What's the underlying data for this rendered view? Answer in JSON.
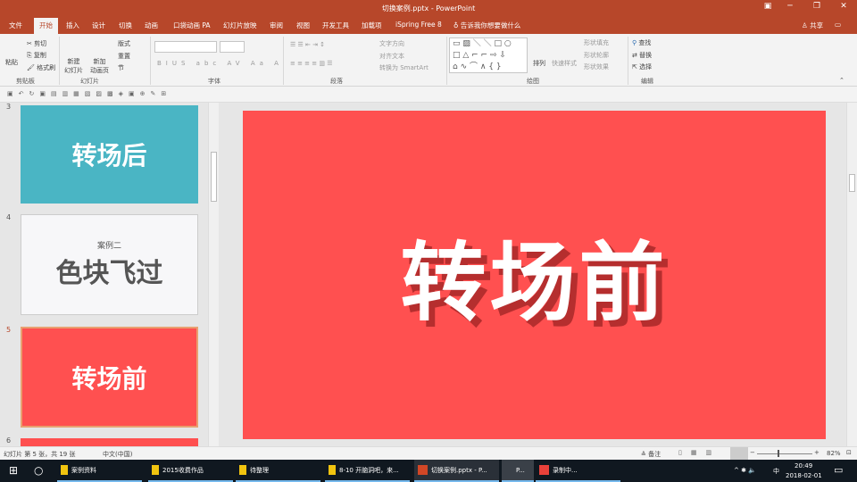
{
  "title": "切换案例.pptx - PowerPoint",
  "tabs": [
    "文件",
    "开始",
    "插入",
    "设计",
    "切换",
    "动画",
    "口袋动画 PA",
    "幻灯片放映",
    "审阅",
    "视图",
    "开发工具",
    "加载项",
    "iSpring Free 8"
  ],
  "tell_me": "告诉我你想要做什么",
  "share": "共享",
  "ribbon": {
    "clipboard": {
      "paste": "粘贴",
      "cut": "剪切",
      "copy": "复制",
      "format_painter": "格式刷",
      "label": "剪贴板"
    },
    "slides": {
      "new_slide": "新建\n幻灯片",
      "new_anim_page": "新加\n动画页",
      "layout": "版式",
      "reset": "重置",
      "section": "节",
      "label": "幻灯片"
    },
    "font": {
      "label": "字体"
    },
    "paragraph": {
      "text_direction": "文字方向",
      "align_text": "对齐文本",
      "smartart": "转换为 SmartArt",
      "label": "段落"
    },
    "drawing": {
      "arrange": "排列",
      "quick_styles": "快速样式",
      "fill": "形状填充",
      "outline": "形状轮廓",
      "effects": "形状效果",
      "label": "绘图"
    },
    "editing": {
      "find": "查找",
      "replace": "替换",
      "select": "选择",
      "label": "编辑"
    }
  },
  "thumbnails": [
    {
      "num": "3",
      "text": "转场后",
      "color": "#4ab5c4"
    },
    {
      "num": "4",
      "subtitle": "案例二",
      "text": "色块飞过",
      "color": "#f7f7f9"
    },
    {
      "num": "5",
      "text": "转场前",
      "color": "#ff5050"
    },
    {
      "num": "6",
      "color": "#ff5050"
    }
  ],
  "slide_text": "转场前",
  "status": {
    "slide_info": "幻灯片 第 5 张，共 19 张",
    "language": "中文(中国)",
    "notes": "备注",
    "zoom": "82%"
  },
  "taskbar": {
    "items": [
      "案例资料",
      "2015收费作品",
      "待整理",
      "8-10 开脑洞吧，来...",
      "切换案例.pptx - P...",
      "P...",
      "录制中..."
    ],
    "ime": "中",
    "time": "20:49",
    "date": "2018-02-01"
  },
  "colors": {
    "accent": "#b7472a",
    "slide_red": "#ff5050",
    "teal": "#4ab5c4"
  }
}
